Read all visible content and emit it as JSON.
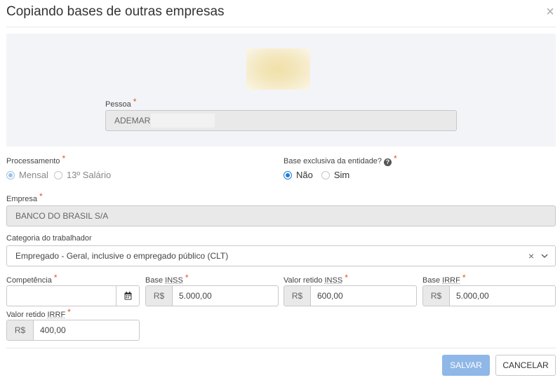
{
  "modal": {
    "title": "Copiando bases de outras empresas",
    "close_glyph": "×"
  },
  "pessoa": {
    "label": "Pessoa",
    "required": "*",
    "value": "ADEMAR A"
  },
  "processamento": {
    "label": "Processamento",
    "required": "*",
    "options": [
      "Mensal",
      "13º Salário"
    ],
    "selected": "Mensal"
  },
  "base_exclusiva": {
    "label": "Base exclusiva da entidade?",
    "required": "*",
    "help_glyph": "?",
    "options": [
      "Não",
      "Sim"
    ],
    "selected": "Não"
  },
  "empresa": {
    "label": "Empresa",
    "required": "*",
    "value": "BANCO DO BRASIL S/A"
  },
  "categoria": {
    "label": "Categoria do trabalhador",
    "value": "Empregado - Geral, inclusive o empregado público (CLT)",
    "clear_glyph": "×"
  },
  "competencia": {
    "label": "Competência",
    "required": "*",
    "value": ""
  },
  "base_inss": {
    "label_prefix": "Base ",
    "label_abbr": "INSS",
    "required": "*",
    "currency": "R$",
    "value": "5.000,00"
  },
  "valor_retido_inss": {
    "label_prefix": "Valor retido ",
    "label_abbr": "INSS",
    "required": "*",
    "currency": "R$",
    "value": "600,00"
  },
  "base_irrf": {
    "label_prefix": "Base ",
    "label_abbr": "IRRF",
    "required": "*",
    "currency": "R$",
    "value": "5.000,00"
  },
  "valor_retido_irrf": {
    "label_prefix": "Valor retido ",
    "label_abbr": "IRRF",
    "required": "*",
    "currency": "R$",
    "value": "400,00"
  },
  "footer": {
    "save_label": "SALVAR",
    "cancel_label": "CANCELAR"
  },
  "colors": {
    "accent": "#1f7ad6",
    "required": "#e0531f",
    "primary_button": "#8fb7e8",
    "panel_bg": "#f3f4f7"
  }
}
